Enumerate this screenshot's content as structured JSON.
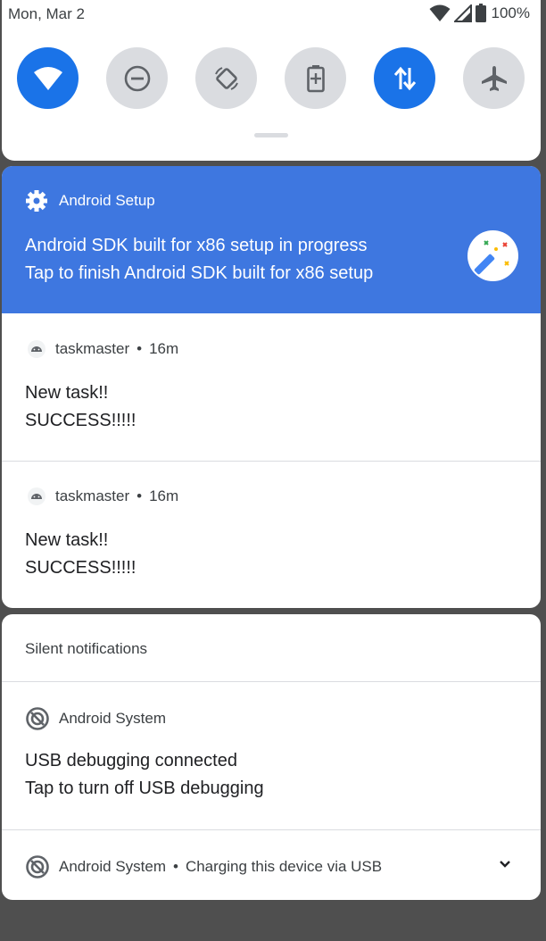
{
  "status_bar": {
    "date": "Mon, Mar 2",
    "battery": "100%"
  },
  "quick_settings": {
    "tiles": [
      {
        "name": "wifi",
        "state": "on",
        "icon": "wifi-icon"
      },
      {
        "name": "do-not-disturb",
        "state": "off",
        "icon": "dnd-icon"
      },
      {
        "name": "auto-rotate",
        "state": "off",
        "icon": "rotate-icon"
      },
      {
        "name": "battery-saver",
        "state": "off",
        "icon": "battery-saver-icon"
      },
      {
        "name": "mobile-data",
        "state": "on",
        "icon": "data-arrows-icon"
      },
      {
        "name": "airplane-mode",
        "state": "off",
        "icon": "airplane-icon"
      }
    ]
  },
  "setup_notification": {
    "app": "Android Setup",
    "line1": "Android SDK built for x86 setup in progress",
    "line2": "Tap to finish Android SDK built for x86 setup",
    "color": "#3e77e0"
  },
  "notifications": [
    {
      "app": "taskmaster",
      "time": "16m",
      "title": "New task!!",
      "text": "SUCCESS!!!!!"
    },
    {
      "app": "taskmaster",
      "time": "16m",
      "title": "New task!!",
      "text": "SUCCESS!!!!!"
    }
  ],
  "silent": {
    "header": "Silent notifications",
    "usb": {
      "app": "Android System",
      "line1": "USB debugging connected",
      "line2": "Tap to turn off USB debugging"
    },
    "charging": {
      "app": "Android System",
      "text": "Charging this device via USB"
    }
  },
  "separator": "•"
}
